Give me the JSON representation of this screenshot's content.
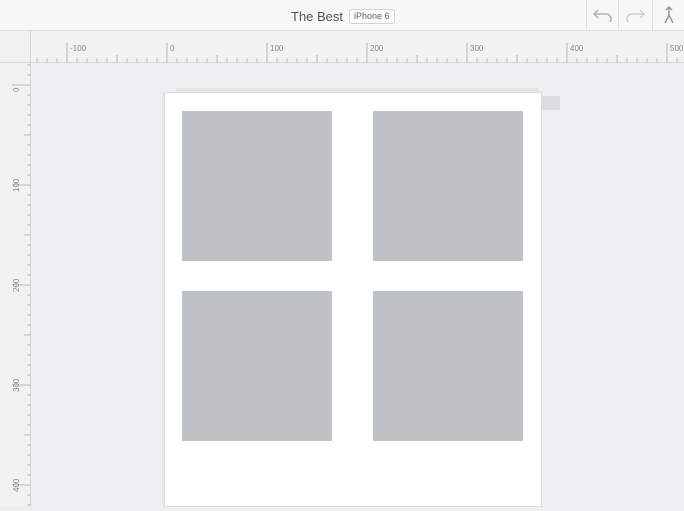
{
  "toolbar": {
    "title": "The Best",
    "device": "iPhone 6",
    "undo_icon": "undo-icon",
    "redo_icon": "redo-icon",
    "share_icon": "share-icon"
  },
  "rulers": {
    "horizontal_labels": [
      "-100",
      "0",
      "100",
      "200",
      "300",
      "400",
      "500"
    ],
    "vertical_labels": [
      "0",
      "100",
      "200",
      "300",
      "400"
    ]
  },
  "artboard": {
    "tiles": [
      {
        "name": "image-placeholder-1",
        "color": "#bec2c5"
      },
      {
        "name": "image-placeholder-2",
        "color": "#bec2c5"
      },
      {
        "name": "image-placeholder-3",
        "color": "#bec2c5"
      },
      {
        "name": "image-placeholder-4",
        "color": "#bec2c5"
      }
    ]
  },
  "colors": {
    "background": "#eeeff0",
    "artboard": "#ffffff",
    "placeholder": "#bec2c5"
  }
}
